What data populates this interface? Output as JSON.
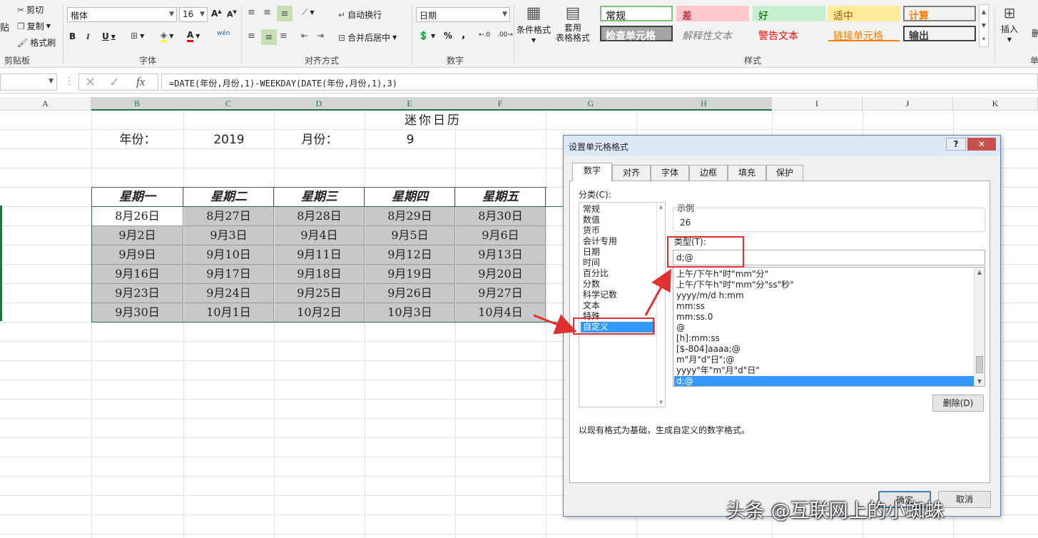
{
  "ribbon": {
    "clipboard": {
      "cut": "剪切",
      "copy": "复制",
      "format_painter": "格式刷",
      "paste": "贴",
      "label": "剪贴板"
    },
    "font": {
      "name": "楷体",
      "size": "16",
      "bold": "B",
      "italic": "I",
      "underline": "U",
      "wen": "wén",
      "label": "字体"
    },
    "alignment": {
      "wrap": "自动换行",
      "merge": "合并后居中",
      "label": "对齐方式"
    },
    "number": {
      "format": "日期",
      "percent": "%",
      "comma": ",",
      "label": "数字"
    },
    "styles": {
      "cond_format": "条件格式",
      "table_format": "套用\n表格格式",
      "cells": [
        {
          "text": "常规",
          "bg": "#ffffff",
          "color": "#000000",
          "border": "#7ec07e"
        },
        {
          "text": "差",
          "bg": "#ffc7ce",
          "color": "#9c0006",
          "border": "#ffc7ce"
        },
        {
          "text": "好",
          "bg": "#c6efce",
          "color": "#006100",
          "border": "#c6efce"
        },
        {
          "text": "适中",
          "bg": "#ffeb9c",
          "color": "#9c5700",
          "border": "#ffeb9c"
        },
        {
          "text": "计算",
          "bg": "#f2f2f2",
          "color": "#fa7d00",
          "border": "#7f7f7f"
        },
        {
          "text": "检查单元格",
          "bg": "#a5a5a5",
          "color": "#ffffff",
          "border": "#3f3f3f"
        },
        {
          "text": "解释性文本",
          "bg": "#f3f3f3",
          "color": "#7f7f7f",
          "border": "#f3f3f3"
        },
        {
          "text": "警告文本",
          "bg": "#f3f3f3",
          "color": "#ff0000",
          "border": "#f3f3f3"
        },
        {
          "text": "链接单元格",
          "bg": "#f3f3f3",
          "color": "#fa7d00",
          "border": "#f3f3f3"
        },
        {
          "text": "输出",
          "bg": "#f2f2f2",
          "color": "#3f3f3f",
          "border": "#3f3f3f"
        }
      ],
      "label": "样式"
    },
    "cells": {
      "insert": "插入",
      "delete": "删",
      "label": "单"
    }
  },
  "formula_bar": {
    "formula": "=DATE(年份,月份,1)-WEEKDAY(DATE(年份,月份,1),3)",
    "fx": "fx"
  },
  "columns": [
    "A",
    "B",
    "C",
    "D",
    "E",
    "F",
    "G",
    "H",
    "I",
    "J",
    "K"
  ],
  "sheet": {
    "title": "迷你日历",
    "year_label": "年份：",
    "year_value": "2019",
    "month_label": "月份：",
    "month_value": "9",
    "weekdays": [
      "星期一",
      "星期二",
      "星期三",
      "星期四",
      "星期五"
    ],
    "rows": [
      [
        "8月26日",
        "8月27日",
        "8月28日",
        "8月29日",
        "8月30日"
      ],
      [
        "9月2日",
        "9月3日",
        "9月4日",
        "9月5日",
        "9月6日"
      ],
      [
        "9月9日",
        "9月10日",
        "9月11日",
        "9月12日",
        "9月13日"
      ],
      [
        "9月16日",
        "9月17日",
        "9月18日",
        "9月19日",
        "9月20日"
      ],
      [
        "9月23日",
        "9月24日",
        "9月25日",
        "9月26日",
        "9月27日"
      ],
      [
        "9月30日",
        "10月1日",
        "10月2日",
        "10月3日",
        "10月4日"
      ]
    ]
  },
  "dialog": {
    "title": "设置单元格格式",
    "help": "?",
    "close": "✕",
    "tabs": [
      "数字",
      "对齐",
      "字体",
      "边框",
      "填充",
      "保护"
    ],
    "category_label": "分类(C):",
    "categories": [
      "常规",
      "数值",
      "货币",
      "会计专用",
      "日期",
      "时间",
      "百分比",
      "分数",
      "科学记数",
      "文本",
      "特殊",
      "自定义"
    ],
    "selected_category": "自定义",
    "sample_label": "示例",
    "sample_value": "26",
    "type_label": "类型(T):",
    "type_value": "d;@",
    "formats": [
      "上午/下午h\"时\"mm\"分\"",
      "上午/下午h\"时\"mm\"分\"ss\"秒\"",
      "yyyy/m/d h:mm",
      "mm:ss",
      "mm:ss.0",
      "@",
      "[h]:mm:ss",
      "[$-804]aaaa;@",
      "m\"月\"d\"日\";@",
      "yyyy\"年\"m\"月\"d\"日\"",
      "d;@"
    ],
    "selected_format": "d;@",
    "delete_button": "删除(D)",
    "description": "以现有格式为基础，生成自定义的数字格式。",
    "ok_button": "确定",
    "cancel_button": "取消"
  },
  "watermark": "头条 @互联网上的小蜘蛛"
}
